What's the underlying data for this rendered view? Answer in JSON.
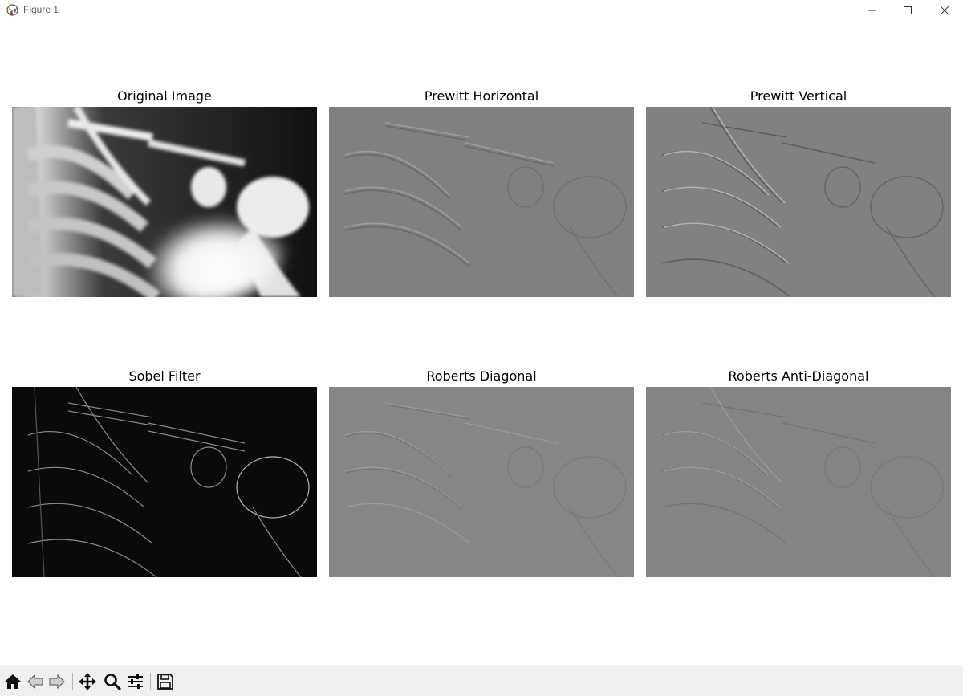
{
  "window": {
    "title": "Figure 1",
    "controls": [
      "minimize",
      "maximize",
      "close"
    ]
  },
  "figure": {
    "panels": [
      {
        "title": "Original Image",
        "kind": "original"
      },
      {
        "title": "Prewitt Horizontal",
        "kind": "emboss-h"
      },
      {
        "title": "Prewitt Vertical",
        "kind": "emboss-v"
      },
      {
        "title": "Sobel Filter",
        "kind": "edge-magnitude"
      },
      {
        "title": "Roberts Diagonal",
        "kind": "emboss-d"
      },
      {
        "title": "Roberts Anti-Diagonal",
        "kind": "emboss-ad"
      }
    ]
  },
  "toolbar": {
    "buttons": [
      {
        "name": "home",
        "icon": "home-icon"
      },
      {
        "name": "back",
        "icon": "back-arrow-icon"
      },
      {
        "name": "forward",
        "icon": "forward-arrow-icon"
      },
      {
        "name": "pan",
        "icon": "move-icon"
      },
      {
        "name": "zoom",
        "icon": "magnifier-icon"
      },
      {
        "name": "configure-subplots",
        "icon": "sliders-icon"
      },
      {
        "name": "save",
        "icon": "floppy-disk-icon"
      }
    ]
  }
}
